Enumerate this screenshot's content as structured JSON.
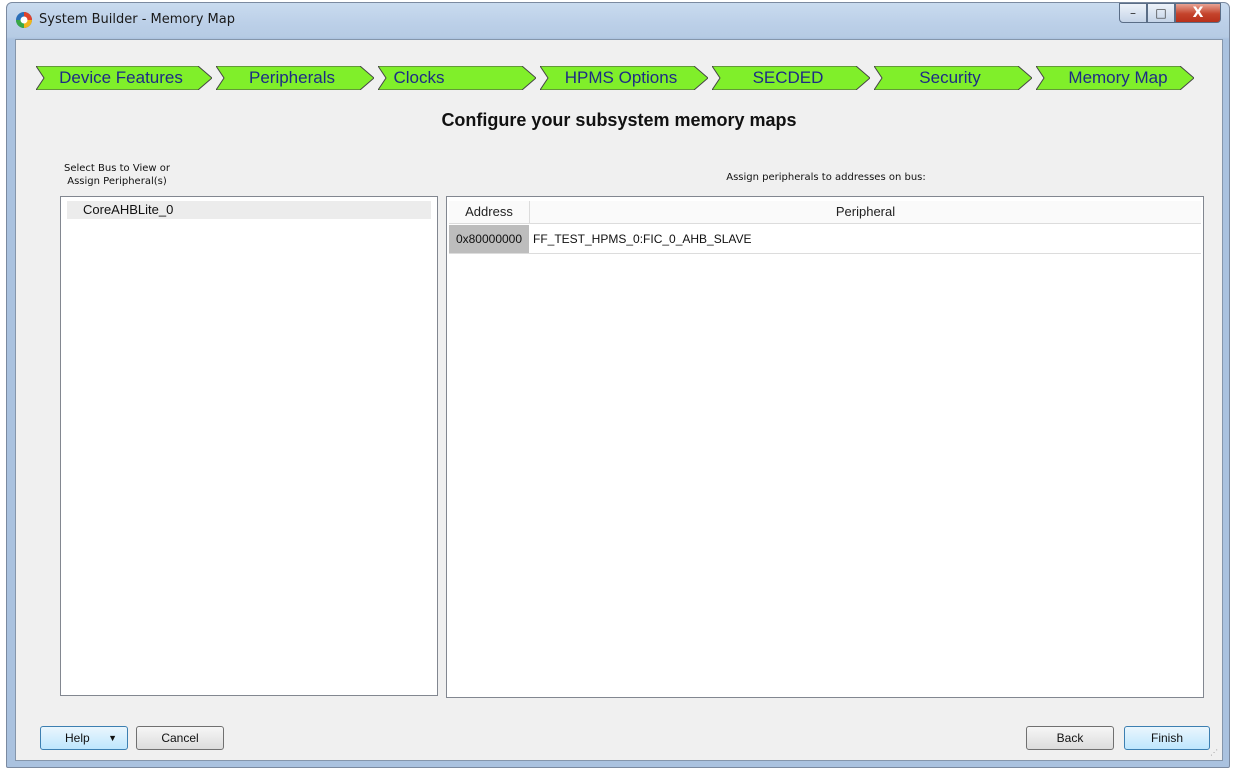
{
  "window": {
    "title": "System Builder - Memory Map",
    "controls": {
      "minimize": "–",
      "maximize": "□",
      "close": "X"
    }
  },
  "wizard": {
    "steps": [
      {
        "label": "Device Features"
      },
      {
        "label": "Peripherals"
      },
      {
        "label": "Clocks"
      },
      {
        "label": "HPMS Options"
      },
      {
        "label": "SECDED"
      },
      {
        "label": "Security"
      },
      {
        "label": "Memory Map"
      }
    ],
    "step_color": "#80ef2a",
    "step_text_color": "#1d2b86"
  },
  "page": {
    "heading": "Configure your subsystem memory maps",
    "left_caption_line1": "Select Bus to View or",
    "left_caption_line2": "Assign Peripheral(s)",
    "right_caption": "Assign peripherals to addresses on bus:"
  },
  "bus_list": {
    "items": [
      {
        "label": "CoreAHBLite_0"
      }
    ]
  },
  "memory_map": {
    "columns": {
      "address": "Address",
      "peripheral": "Peripheral"
    },
    "rows": [
      {
        "address": "0x80000000",
        "peripheral": "FF_TEST_HPMS_0:FIC_0_AHB_SLAVE"
      }
    ]
  },
  "footer": {
    "help_label": "Help",
    "help_dropdown_icon": "caret-down-icon",
    "cancel_label": "Cancel",
    "back_label": "Back",
    "finish_label": "Finish"
  }
}
